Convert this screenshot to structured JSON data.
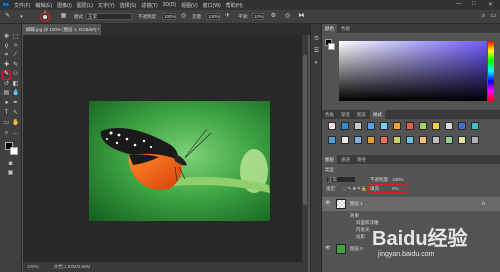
{
  "menubar": {
    "items": [
      "文件(F)",
      "编辑(E)",
      "图像(I)",
      "图层(L)",
      "文字(Y)",
      "选择(S)",
      "滤镜(T)",
      "3D(D)",
      "视图(V)",
      "窗口(W)",
      "帮助(H)"
    ],
    "window_controls": [
      "—",
      "□",
      "✕"
    ]
  },
  "options": {
    "brush_size": "2",
    "mode_label": "模式:",
    "mode_value": "正常",
    "opacity_label": "不透明度:",
    "opacity_value": "100%",
    "flow_label": "流量:",
    "flow_value": "100%",
    "smoothing_label": "平滑:",
    "smoothing_value": "10%"
  },
  "document": {
    "tab_title": "蝴蝶.jpg @ 100% (图层 1, RGB/8#) *",
    "status_zoom": "100%",
    "status_doc": "文档:1.83M/3.66M"
  },
  "panels": {
    "color_tabs": [
      "颜色",
      "色板"
    ],
    "swatch_tabs": [
      "色板",
      "渐变",
      "图案",
      "样式"
    ],
    "layers_tabs": [
      "图层",
      "通道",
      "路径"
    ],
    "kind_label": "类型",
    "blend_value": "正常",
    "opacity_label": "不透明度:",
    "opacity_value": "100%",
    "lock_label": "锁定:",
    "fill_label": "填充:",
    "fill_value": "0%",
    "layers": [
      {
        "name": "图层 1"
      },
      {
        "name": "效果"
      },
      {
        "name": "斜面和浮雕"
      },
      {
        "name": "内发光"
      },
      {
        "name": "投影"
      },
      {
        "name": "图层 0"
      }
    ]
  },
  "watermark": {
    "brand": "Baidu经验",
    "url": "jingyan.baidu.com"
  },
  "colors": {
    "accent_red": "#e02020",
    "panel_bg": "#535353",
    "canvas_bg": "#282828"
  }
}
